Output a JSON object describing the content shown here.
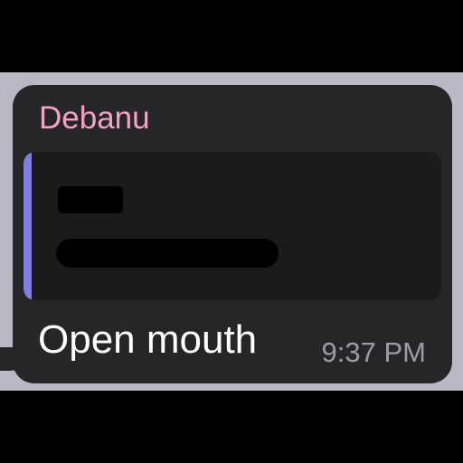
{
  "message": {
    "sender": "Debanu",
    "text": "Open mouth",
    "time": "9:37 PM",
    "sender_color": "#f5a1c4",
    "reply_accent_color": "#7f7fe4"
  },
  "reply": {
    "content_redacted": true
  }
}
